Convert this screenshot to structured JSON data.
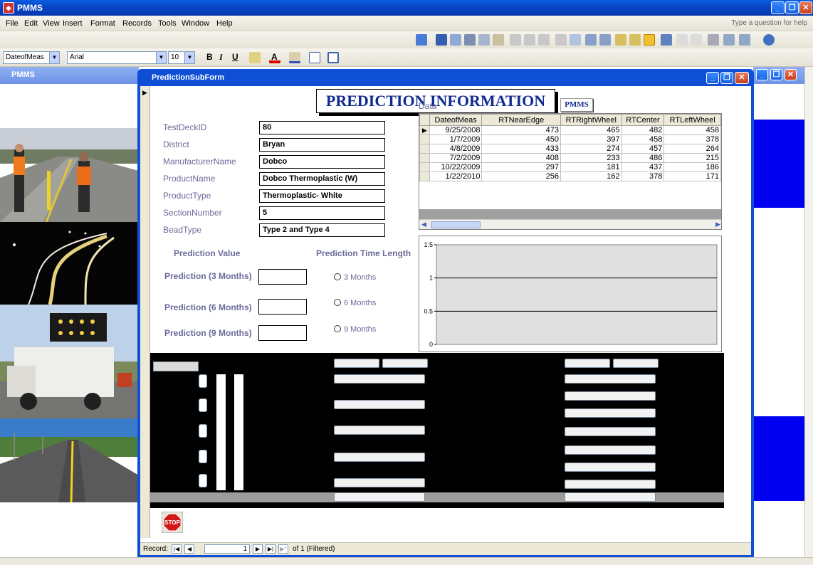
{
  "app": {
    "title": "PMMS",
    "help_placeholder": "Type a question for help"
  },
  "menu": [
    "File",
    "Edit",
    "View",
    "Insert",
    "Format",
    "Records",
    "Tools",
    "Window",
    "Help"
  ],
  "format_toolbar": {
    "field": "DateofMeas",
    "font": "Arial",
    "size": "10"
  },
  "left_window": {
    "title": "PMMS"
  },
  "subform": {
    "title": "PredictionSubForm",
    "heading": "PREDICTION INFORMATION",
    "fields": [
      {
        "label": "TestDeckID",
        "value": "80"
      },
      {
        "label": "District",
        "value": "Bryan"
      },
      {
        "label": "ManufacturerName",
        "value": "Dobco"
      },
      {
        "label": "ProductName",
        "value": "Dobco Thermoplastic (W)"
      },
      {
        "label": "ProductType",
        "value": "Thermoplastic- White"
      },
      {
        "label": "SectionNumber",
        "value": "5"
      },
      {
        "label": "BeadType",
        "value": "Type 2 and Type 4"
      }
    ],
    "prediction_value_header": "Prediction Value",
    "prediction_time_header": "Prediction Time Length",
    "predictions": [
      {
        "label": "Prediction (3 Months)",
        "option": "3 Months"
      },
      {
        "label": "Prediction (6 Months)",
        "option": "6 Months"
      },
      {
        "label": "Prediction (9 Months)",
        "option": "9 Months"
      }
    ],
    "data_label": "Data",
    "pmms_button": "PMMS",
    "table": {
      "columns": [
        "DateofMeas",
        "RTNearEdge",
        "RTRightWheel",
        "RTCenter",
        "RTLeftWheel"
      ],
      "rows": [
        [
          "9/25/2008",
          "473",
          "465",
          "482",
          "458"
        ],
        [
          "1/7/2009",
          "450",
          "397",
          "458",
          "378"
        ],
        [
          "4/8/2009",
          "433",
          "274",
          "457",
          "264"
        ],
        [
          "7/2/2009",
          "408",
          "233",
          "486",
          "215"
        ],
        [
          "10/22/2009",
          "297",
          "181",
          "437",
          "186"
        ],
        [
          "1/22/2010",
          "256",
          "162",
          "378",
          "171"
        ]
      ]
    },
    "stop_label": "STOP",
    "nav": {
      "record_label": "Record:",
      "current": "1",
      "total_text": "of 1 (Filtered)"
    }
  },
  "chart_data": {
    "type": "line",
    "title": "",
    "xlabel": "",
    "ylabel": "",
    "ylim": [
      0,
      1.5
    ],
    "yticks": [
      "0",
      "0.5",
      "1",
      "1.5"
    ],
    "series": [],
    "grid": true
  }
}
